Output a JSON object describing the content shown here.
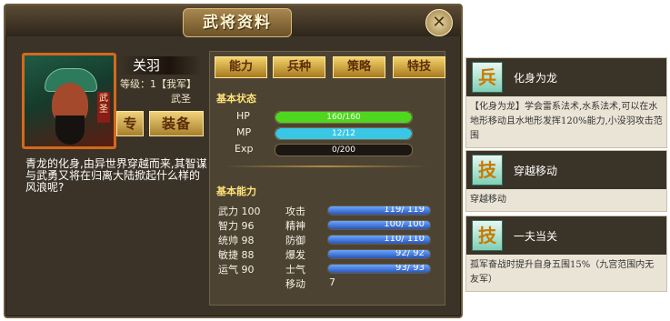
{
  "window": {
    "title": "武将资料",
    "close_label": "✕"
  },
  "hero": {
    "name": "关羽",
    "level": "等级：1【我军】",
    "rank": "武圣",
    "portrait_tag": "武圣",
    "btn_special": "专",
    "btn_equip": "装备",
    "bio": "青龙的化身,由异世界穿越而来,其智谋与武勇又将在归离大陆掀起什么样的风浪呢?"
  },
  "tabs": [
    "能力",
    "兵种",
    "策略",
    "特技"
  ],
  "basic_status": {
    "label": "基本状态",
    "bars": [
      {
        "name": "HP",
        "text": "160/160",
        "fraction": 1.0,
        "color": "#4fd61f"
      },
      {
        "name": "MP",
        "text": "12/12",
        "fraction": 1.0,
        "color": "#39c7e6"
      },
      {
        "name": "Exp",
        "text": "0/200",
        "fraction": 0.0,
        "color": "#e0b030"
      }
    ]
  },
  "basic_ability": {
    "label": "基本能力",
    "left": [
      {
        "name": "武力",
        "value": "100"
      },
      {
        "name": "智力",
        "value": "96"
      },
      {
        "name": "统帅",
        "value": "98"
      },
      {
        "name": "敏捷",
        "value": "88"
      },
      {
        "name": "运气",
        "value": "90"
      }
    ],
    "right": [
      {
        "name": "攻击",
        "text": "119/ 119",
        "fraction": 1.0
      },
      {
        "name": "精神",
        "text": "100/ 100",
        "fraction": 1.0
      },
      {
        "name": "防御",
        "text": "110/ 110",
        "fraction": 1.0
      },
      {
        "name": "爆发",
        "text": "92/ 92",
        "fraction": 1.0
      },
      {
        "name": "士气",
        "text": "93/ 93",
        "fraction": 1.0
      }
    ],
    "move_label": "移动",
    "move_value": "7"
  },
  "skills": [
    {
      "badge": "兵",
      "name": "化身为龙",
      "desc": "【化身为龙】学会雷系法术,水系法术,可以在水地形移动且水地形发挥120%能力,小没羽攻击范围"
    },
    {
      "badge": "技",
      "name": "穿越移动",
      "desc": "穿越移动"
    },
    {
      "badge": "技",
      "name": "一夫当关",
      "desc": "孤军奋战时提升自身五围15%（九宫范围内无友军）"
    }
  ]
}
